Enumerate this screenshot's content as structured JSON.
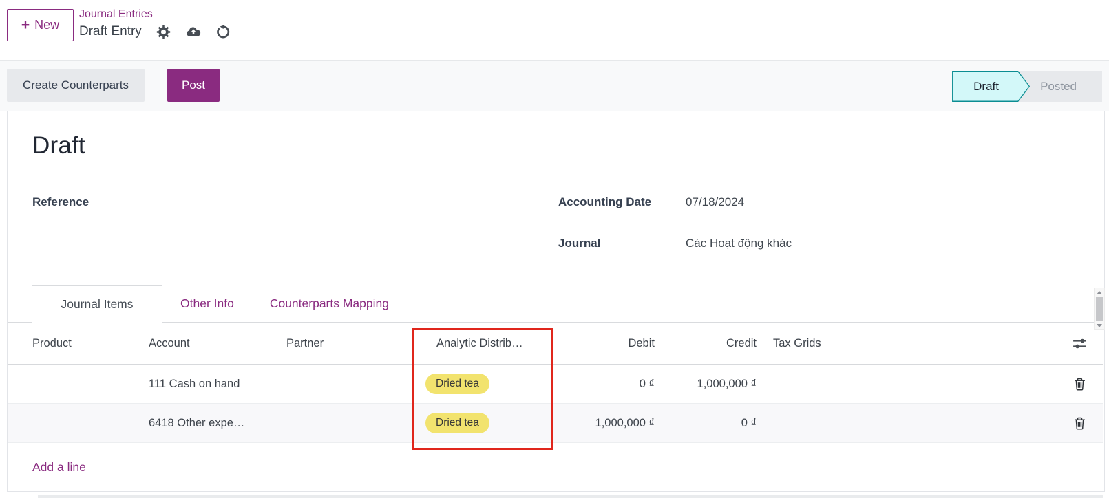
{
  "header": {
    "new_label": "New",
    "breadcrumb_parent": "Journal Entries",
    "breadcrumb_current": "Draft Entry"
  },
  "actions": {
    "create_counterparts": "Create Counterparts",
    "post": "Post"
  },
  "status": {
    "draft": "Draft",
    "posted": "Posted",
    "active_state": "Draft"
  },
  "form": {
    "title": "Draft",
    "reference_label": "Reference",
    "accounting_date_label": "Accounting Date",
    "accounting_date_value": "07/18/2024",
    "journal_label": "Journal",
    "journal_value": "Các Hoạt động khác"
  },
  "tabs": [
    {
      "label": "Journal Items",
      "active": true
    },
    {
      "label": "Other Info",
      "active": false
    },
    {
      "label": "Counterparts Mapping",
      "active": false
    }
  ],
  "table": {
    "columns": [
      "Product",
      "Account",
      "Partner",
      "Analytic Distrib…",
      "Debit",
      "Credit",
      "Tax Grids"
    ],
    "rows": [
      {
        "account": "111 Cash on hand",
        "analytic_tag": "Dried tea",
        "debit": "0 ₫",
        "credit": "1,000,000 ₫"
      },
      {
        "account": "6418 Other expe…",
        "analytic_tag": "Dried tea",
        "debit": "1,000,000 ₫",
        "credit": "0 ₫"
      }
    ],
    "add_line_label": "Add a line"
  },
  "colors": {
    "accent_purple": "#8a2b80",
    "tag_yellow": "#f2e36e",
    "highlight_red": "#e0261c",
    "status_teal_border": "#0b8d92",
    "status_draft_bg": "#d3f8f9"
  }
}
